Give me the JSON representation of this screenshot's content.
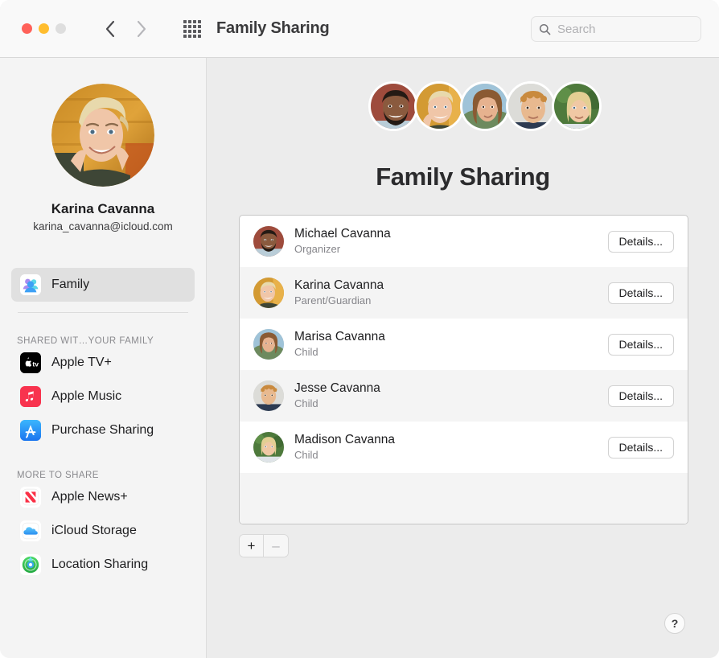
{
  "window": {
    "title": "Family Sharing",
    "traffic_lights": [
      "close",
      "minimize",
      "zoom"
    ],
    "back_label": "Back",
    "forward_label": "Forward",
    "grid_label": "Show All"
  },
  "search": {
    "placeholder": "Search",
    "value": ""
  },
  "sidebar": {
    "profile": {
      "name": "Karina Cavanna",
      "email": "karina_cavanna@icloud.com"
    },
    "selected_item": {
      "label": "Family",
      "icon": "family-icon"
    },
    "sections": [
      {
        "title": "SHARED WIT…YOUR FAMILY",
        "items": [
          {
            "label": "Apple TV+",
            "icon": "apple-tv-icon"
          },
          {
            "label": "Apple Music",
            "icon": "apple-music-icon"
          },
          {
            "label": "Purchase Sharing",
            "icon": "app-store-icon"
          }
        ]
      },
      {
        "title": "MORE TO SHARE",
        "items": [
          {
            "label": "Apple News+",
            "icon": "apple-news-icon"
          },
          {
            "label": "iCloud Storage",
            "icon": "icloud-icon"
          },
          {
            "label": "Location Sharing",
            "icon": "find-my-icon"
          }
        ]
      }
    ]
  },
  "main": {
    "title": "Family Sharing",
    "avatar_cluster": [
      {
        "name": "Michael Cavanna"
      },
      {
        "name": "Karina Cavanna"
      },
      {
        "name": "Marisa Cavanna"
      },
      {
        "name": "Jesse Cavanna"
      },
      {
        "name": "Madison Cavanna"
      }
    ],
    "members": [
      {
        "name": "Michael Cavanna",
        "role": "Organizer",
        "details_label": "Details..."
      },
      {
        "name": "Karina Cavanna",
        "role": "Parent/Guardian",
        "details_label": "Details..."
      },
      {
        "name": "Marisa Cavanna",
        "role": "Child",
        "details_label": "Details..."
      },
      {
        "name": "Jesse Cavanna",
        "role": "Child",
        "details_label": "Details..."
      },
      {
        "name": "Madison Cavanna",
        "role": "Child",
        "details_label": "Details..."
      }
    ],
    "add_button_label": "+",
    "remove_button_label": "–",
    "help_button_label": "?"
  },
  "colors": {
    "accent_blue": "#1e7df2",
    "music_red": "#f8334e",
    "news_red": "#fa2f45",
    "findmy_green": "#34c759",
    "sidebar_bg": "#f4f4f4",
    "content_bg": "#ececec"
  }
}
